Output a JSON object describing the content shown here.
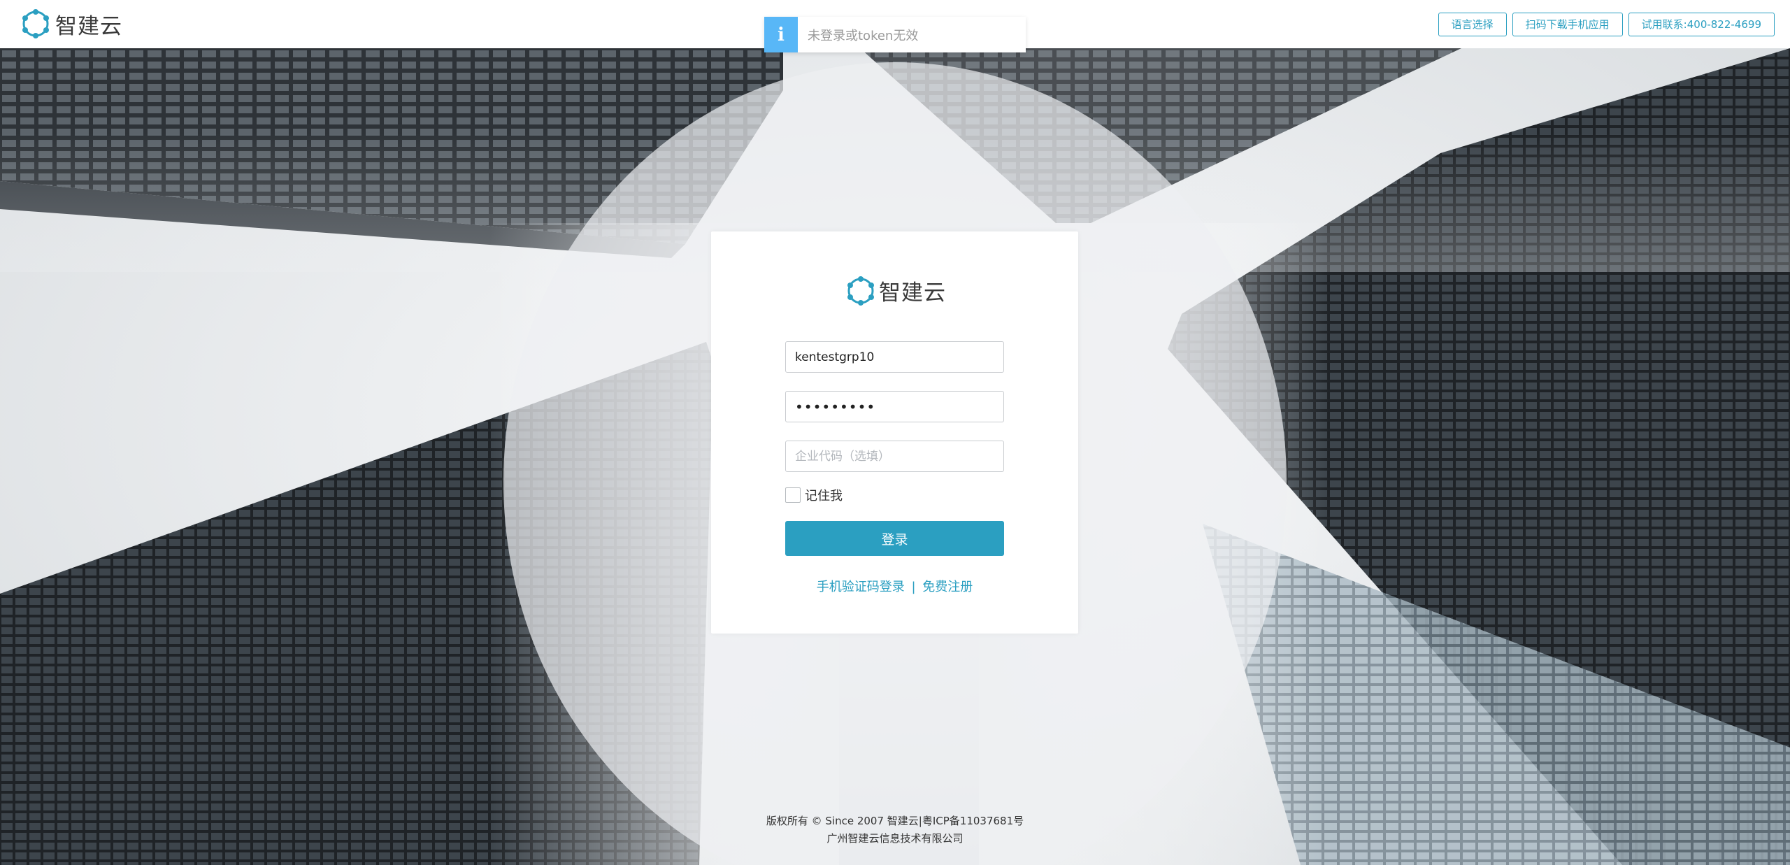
{
  "brand": {
    "name": "智建云"
  },
  "header": {
    "buttons": [
      {
        "label": "语言选择"
      },
      {
        "label": "扫码下载手机应用"
      },
      {
        "label": "试用联系:400-822-4699"
      }
    ]
  },
  "toast": {
    "icon": "info-icon",
    "glyph": "i",
    "message": "未登录或token无效"
  },
  "login": {
    "username_value": "kentestgrp10",
    "password_value": "•••••••••",
    "company_placeholder": "企业代码（选填）",
    "remember_label": "记住我",
    "submit_label": "登录",
    "sms_login_link": "手机验证码登录",
    "separator": "|",
    "register_link": "免费注册"
  },
  "footer": {
    "line1": "版权所有 © Since 2007 智建云|粤ICP备11037681号",
    "line2": "广州智建云信息技术有限公司"
  },
  "colors": {
    "accent": "#2b9fc1",
    "toast_icon_bg": "#58b7f7",
    "card_bg": "#ffffff"
  }
}
